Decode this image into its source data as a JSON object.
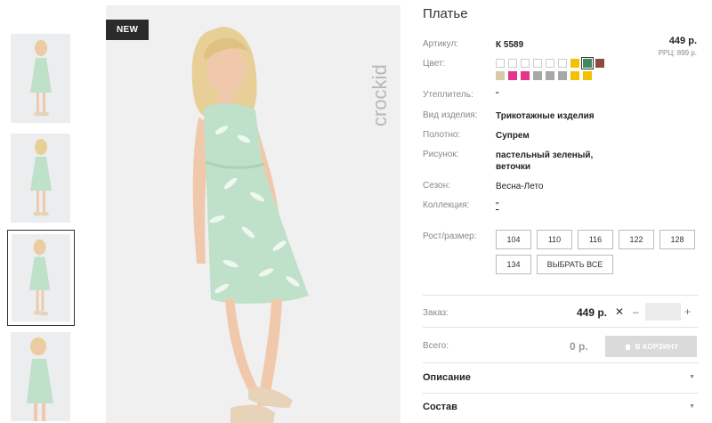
{
  "badge_new": "NEW",
  "brand_text": "crockid",
  "title": "Платье",
  "fields": {
    "article_label": "Артикул:",
    "article_value": "К 5589",
    "color_label": "Цвет:",
    "insulation_label": "Утеплитель:",
    "insulation_value": "\"",
    "type_label": "Вид изделия:",
    "type_value": "Трикотажные изделия",
    "fabric_label": "Полотно:",
    "fabric_value": "Супрем",
    "pattern_label": "Рисунок:",
    "pattern_value_line1": "пастельный зеленый,",
    "pattern_value_line2": "веточки",
    "season_label": "Сезон:",
    "season_value": "Весна-Лето",
    "collection_label": "Коллекция:",
    "collection_value": "\"",
    "size_label": "Рост/размер:"
  },
  "price": "449 р.",
  "rrc": "РРЦ: 899 р.",
  "swatch_colors": [
    "#ffffff",
    "#ffffff",
    "#ffffff",
    "#ffffff",
    "#ffffff",
    "#ffffff",
    "#f2c200",
    "#3f8a5e",
    "#8b4a3c",
    "#d8c8a8",
    "#e8338a",
    "#e8338a",
    "#a8a8a8",
    "#a8a8a8",
    "#a8a8a8",
    "#f2c200",
    "#f2c200"
  ],
  "selected_swatch_color": "#3f8a5e",
  "sizes": [
    "104",
    "110",
    "116",
    "122",
    "128",
    "134"
  ],
  "select_all_label": "ВЫБРАТЬ ВСЕ",
  "order": {
    "label": "Заказ:",
    "price": "449 р.",
    "remove_symbol": "✕",
    "minus": "–",
    "plus": "+",
    "qty": ""
  },
  "total": {
    "label": "Всего:",
    "price": "0 р.",
    "cart_label": "В КОРЗИНУ"
  },
  "accordion": {
    "description": "Описание",
    "composition": "Состав",
    "arrow": "▼"
  },
  "colors": {
    "dress": "#bfe0c9",
    "leaf": "#f4fbf6",
    "hair": "#e8cf97",
    "skin": "#f0c9ad",
    "shoe": "#e6d3ba"
  }
}
